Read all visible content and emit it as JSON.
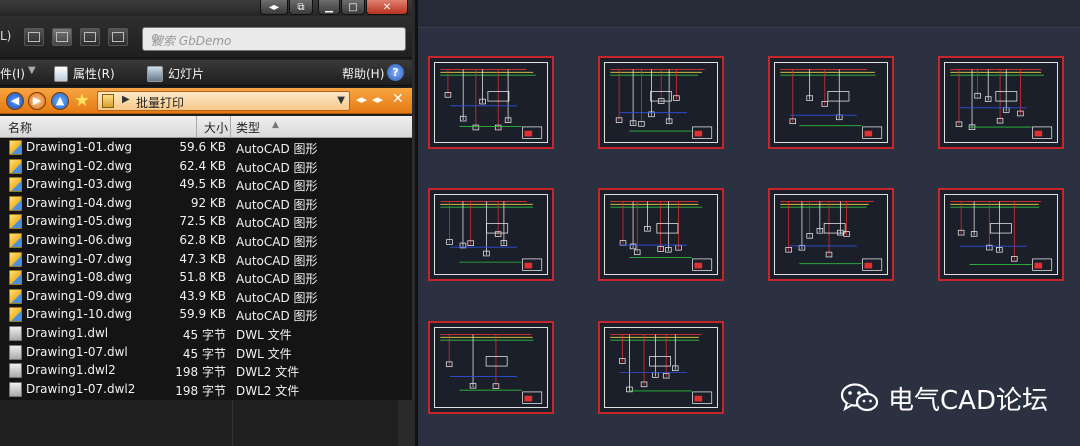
{
  "explorer": {
    "viewbar_left_label": "L)",
    "search_placeholder": "搜索 GbDemo",
    "cmd": {
      "file": "件(I)",
      "properties": "属性(R)",
      "slideshow": "幻灯片",
      "help": "帮助(H)"
    },
    "address": {
      "path": "批量打印"
    },
    "columns": {
      "name": "名称",
      "size": "大小",
      "type": "类型"
    },
    "files": [
      {
        "name": "Drawing1-01.dwg",
        "size": "59.6 KB",
        "type": "AutoCAD 图形",
        "icon": "dwg-file-icon"
      },
      {
        "name": "Drawing1-02.dwg",
        "size": "62.4 KB",
        "type": "AutoCAD 图形",
        "icon": "dwg-file-icon"
      },
      {
        "name": "Drawing1-03.dwg",
        "size": "49.5 KB",
        "type": "AutoCAD 图形",
        "icon": "dwg-file-icon"
      },
      {
        "name": "Drawing1-04.dwg",
        "size": "92 KB",
        "type": "AutoCAD 图形",
        "icon": "dwg-file-icon"
      },
      {
        "name": "Drawing1-05.dwg",
        "size": "72.5 KB",
        "type": "AutoCAD 图形",
        "icon": "dwg-file-icon"
      },
      {
        "name": "Drawing1-06.dwg",
        "size": "62.8 KB",
        "type": "AutoCAD 图形",
        "icon": "dwg-file-icon"
      },
      {
        "name": "Drawing1-07.dwg",
        "size": "47.3 KB",
        "type": "AutoCAD 图形",
        "icon": "dwg-file-icon"
      },
      {
        "name": "Drawing1-08.dwg",
        "size": "51.8 KB",
        "type": "AutoCAD 图形",
        "icon": "dwg-file-icon"
      },
      {
        "name": "Drawing1-09.dwg",
        "size": "43.9 KB",
        "type": "AutoCAD 图形",
        "icon": "dwg-file-icon"
      },
      {
        "name": "Drawing1-10.dwg",
        "size": "59.9 KB",
        "type": "AutoCAD 图形",
        "icon": "dwg-file-icon"
      },
      {
        "name": "Drawing1.dwl",
        "size": "45 字节",
        "type": "DWL 文件",
        "icon": "generic-file-icon"
      },
      {
        "name": "Drawing1-07.dwl",
        "size": "45 字节",
        "type": "DWL 文件",
        "icon": "generic-file-icon"
      },
      {
        "name": "Drawing1.dwl2",
        "size": "198 字节",
        "type": "DWL2 文件",
        "icon": "generic-file-icon"
      },
      {
        "name": "Drawing1-07.dwl2",
        "size": "198 字节",
        "type": "DWL2 文件",
        "icon": "generic-file-icon"
      }
    ]
  },
  "cad": {
    "sheet_count": 10,
    "colors": {
      "background": "#2b3140",
      "sheet_border": "#c8252b",
      "wire_red": "#e03030",
      "wire_green": "#2fbf3a",
      "wire_blue": "#2f50e0",
      "wire_white": "#e6e6e6",
      "wire_yellow": "#e8d040"
    }
  },
  "watermark": {
    "text": "电气CAD论坛",
    "icon": "wechat-icon"
  }
}
